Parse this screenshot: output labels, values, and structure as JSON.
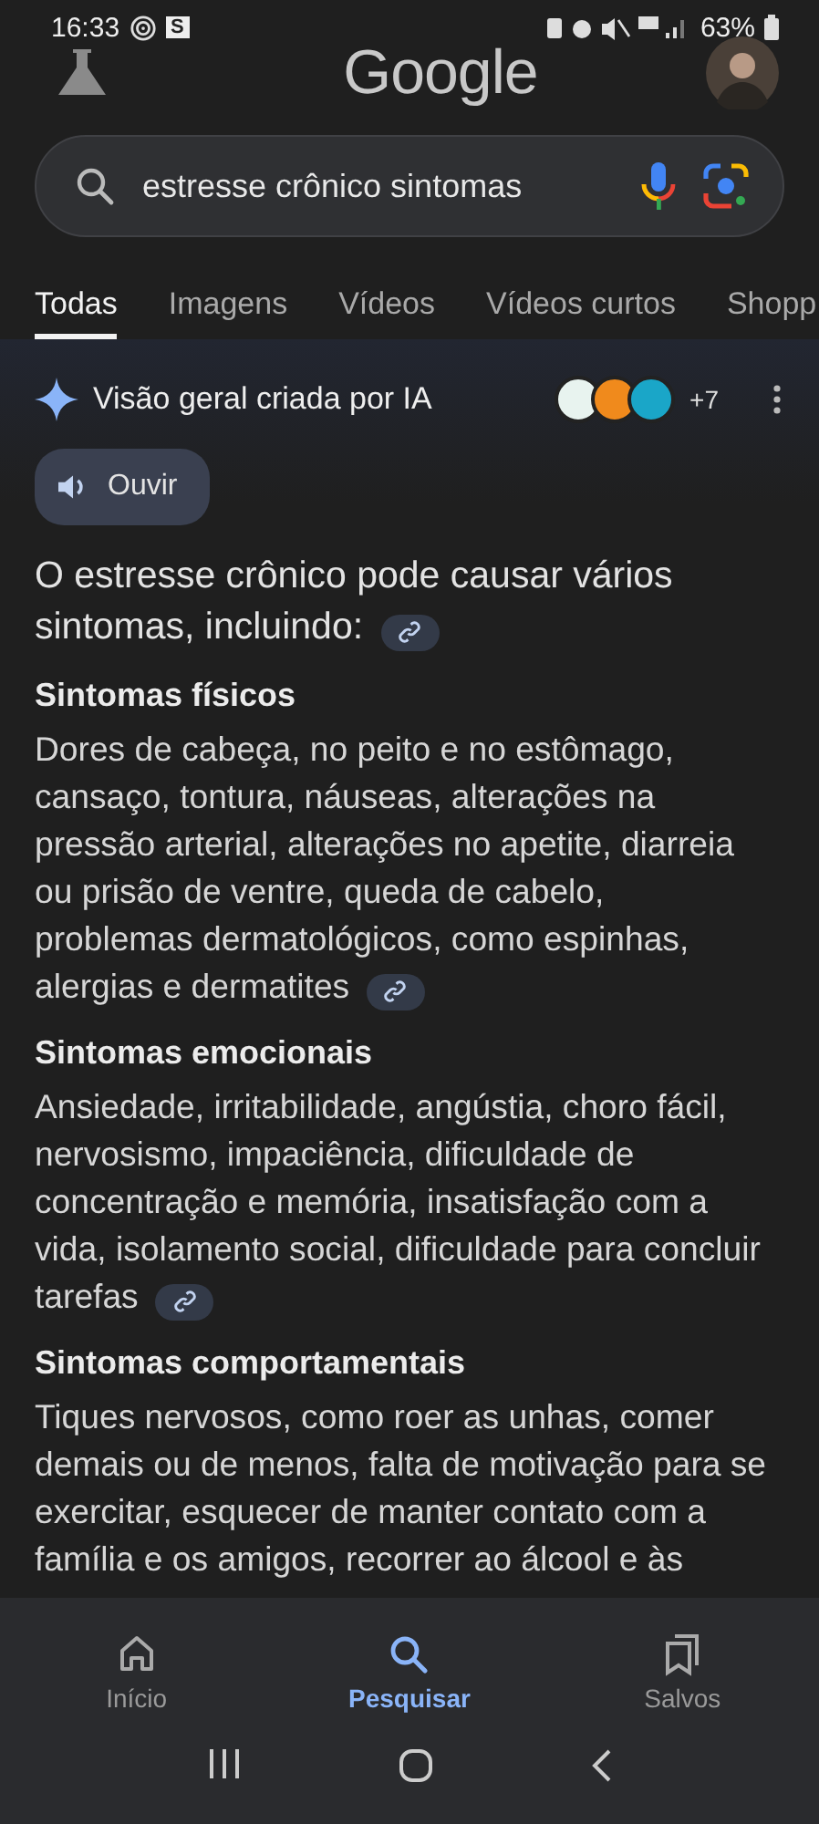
{
  "status_bar": {
    "time": "16:33",
    "notification": "S",
    "battery": "63%"
  },
  "header": {
    "logo": "Google"
  },
  "search": {
    "value": "estresse crônico sintomas"
  },
  "tabs": [
    {
      "label": "Todas",
      "selected": true
    },
    {
      "label": "Imagens",
      "selected": false
    },
    {
      "label": "Vídeos",
      "selected": false
    },
    {
      "label": "Vídeos curtos",
      "selected": false
    },
    {
      "label": "Shopp",
      "selected": false
    }
  ],
  "ai_overview": {
    "title": "Visão geral criada por IA",
    "sources": [
      {
        "color": "#e8f3ef"
      },
      {
        "color": "#f08a1c"
      },
      {
        "color": "#1aa6c8"
      }
    ],
    "more_sources": "+7",
    "listen_button": "Ouvir",
    "intro": "O estresse crônico pode causar vários sintomas, incluindo:",
    "sections": [
      {
        "heading": "Sintomas físicos",
        "body": "Dores de cabeça, no peito e no estômago, cansaço, tontura, náuseas, alterações na pressão arterial, alterações no apetite, diarreia ou prisão de ventre, queda de cabelo, problemas dermatológicos, como espinhas, alergias e dermatites",
        "link": true
      },
      {
        "heading": "Sintomas emocionais",
        "body": "Ansiedade, irritabilidade, angústia, choro fácil, nervosismo, impaciência, dificuldade de concentração e memória, insatisfação com a vida, isolamento social, dificuldade para concluir tarefas",
        "link": true
      },
      {
        "heading": "Sintomas comportamentais",
        "body": "Tiques nervosos, como roer as unhas, comer demais ou de menos, falta de motivação para se exercitar, esquecer de manter contato com a família e os amigos, recorrer ao álcool e às",
        "link": false
      }
    ]
  },
  "bottom_nav": [
    {
      "label": "Início",
      "kind": "home",
      "selected": false
    },
    {
      "label": "Pesquisar",
      "kind": "search",
      "selected": true
    },
    {
      "label": "Salvos",
      "kind": "saved",
      "selected": false
    }
  ]
}
